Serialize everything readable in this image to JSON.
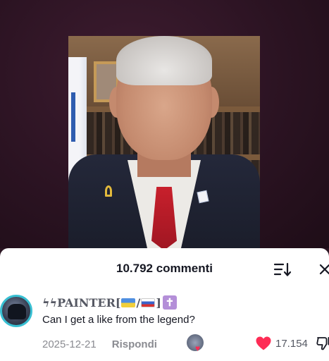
{
  "video": {
    "description_icons": [
      "israel-flag-icon",
      "yellow-ribbon-pin-icon",
      "flag-pin-icon"
    ]
  },
  "comments_panel": {
    "count_label": "10.792 commenti",
    "sort_icon": "sort-icon",
    "close_icon": "close-icon"
  },
  "comment": {
    "username_prefix": "ϟϟPAINTER[",
    "username_sep": "/",
    "username_suffix": "]",
    "badge_symbol": "✝",
    "text": "Can I get a like from the legend?",
    "date": "2025-12-21",
    "reply_label": "Rispondi",
    "likes": "17.154"
  },
  "colors": {
    "accent_like": "#fe2c55",
    "avatar_ring": "#38bfd2",
    "badge": "#b48fd8",
    "text_primary": "#161823",
    "text_secondary": "#8a8b91"
  }
}
